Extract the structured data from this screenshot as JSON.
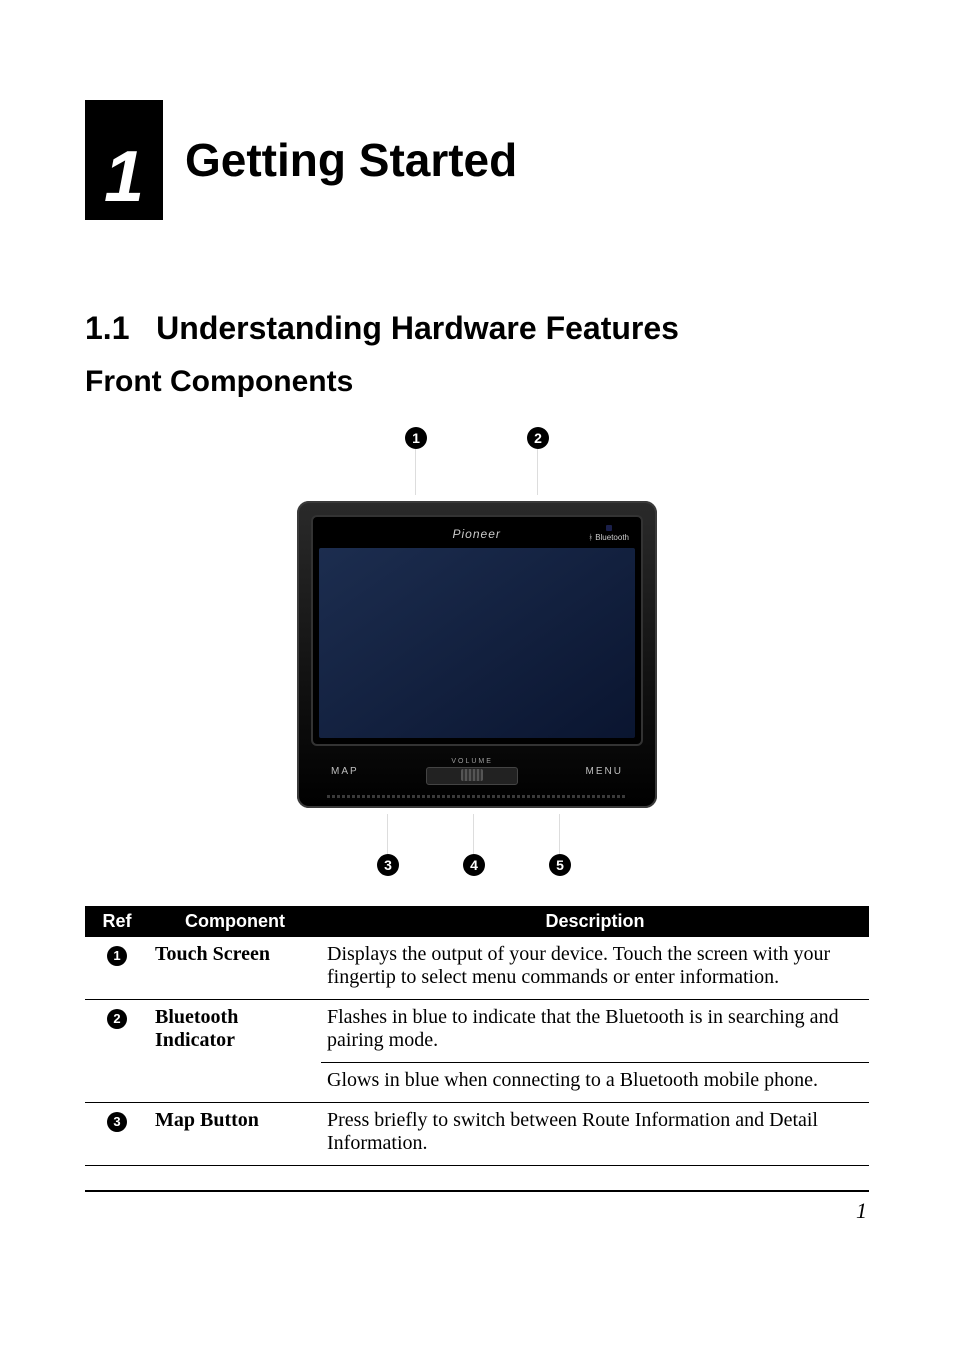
{
  "chapter": {
    "number": "1",
    "title": "Getting Started"
  },
  "section": {
    "number": "1.1",
    "title": "Understanding Hardware Features"
  },
  "subsection": {
    "title": "Front Components"
  },
  "figure": {
    "brand": "Pioneer",
    "bluetooth_label": "Bluetooth",
    "bluetooth_glyph": "ᚼ",
    "volume_label": "VOLUME",
    "map_label": "MAP",
    "menu_label": "MENU",
    "callouts_top": [
      "1",
      "2"
    ],
    "callouts_bottom": [
      "3",
      "4",
      "5"
    ]
  },
  "table": {
    "headers": {
      "ref": "Ref",
      "component": "Component",
      "description": "Description"
    },
    "rows": [
      {
        "ref": "1",
        "component": "Touch Screen",
        "descriptions": [
          "Displays the output of your device. Touch the screen with your fingertip to select menu commands or enter information."
        ]
      },
      {
        "ref": "2",
        "component": "Bluetooth Indicator",
        "descriptions": [
          "Flashes in blue to indicate that the Bluetooth is in searching and pairing mode.",
          "Glows in blue when connecting to a Bluetooth mobile phone."
        ]
      },
      {
        "ref": "3",
        "component": "Map Button",
        "descriptions": [
          "Press briefly to switch between Route Information and Detail Information."
        ]
      }
    ]
  },
  "page_number": "1"
}
